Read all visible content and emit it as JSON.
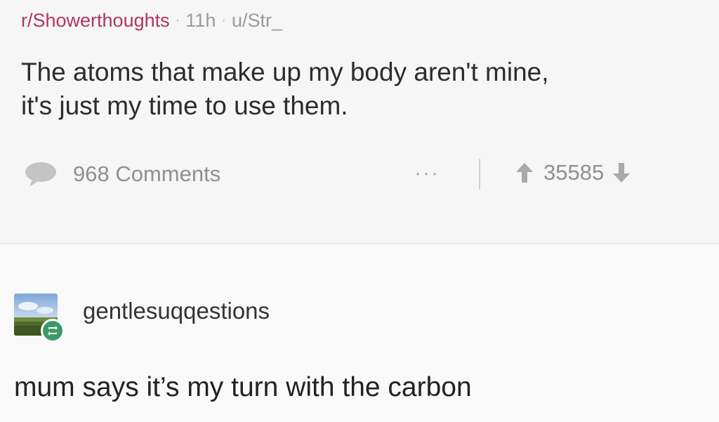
{
  "post": {
    "subreddit": "r/Showerthoughts",
    "separator": "·",
    "time": "11h",
    "author": "u/Str_",
    "title_line1": "The atoms that make up my body aren't mine,",
    "title_line2": "it's just my time to use them.",
    "comments_label": "968 Comments",
    "more_label": "···",
    "score": "35585"
  },
  "reply": {
    "username": "gentlesuqqestions",
    "text": "mum says it’s my turn with the carbon"
  },
  "icons": {
    "comment": "comment-bubble-icon",
    "upvote": "upvote-arrow-icon",
    "downvote": "downvote-arrow-icon",
    "reblog": "reblog-icon"
  },
  "colors": {
    "subreddit": "#b0365a",
    "muted": "#8f8f8f",
    "reblog_badge": "#3d9a66"
  }
}
